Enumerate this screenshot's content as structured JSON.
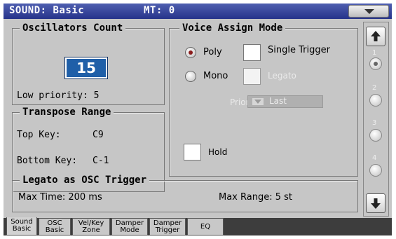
{
  "header": {
    "title": "SOUND: Basic",
    "mt": "MT: 0"
  },
  "oscillators": {
    "title": "Oscillators Count",
    "value": "15",
    "low_priority": "Low priority: 5"
  },
  "transpose": {
    "title": "Transpose Range",
    "top_label": "Top Key:",
    "top_value": "C9",
    "bottom_label": "Bottom Key:",
    "bottom_value": "C-1"
  },
  "voice_assign": {
    "title": "Voice Assign Mode",
    "poly": "Poly",
    "mono": "Mono",
    "single_trigger": "Single Trigger",
    "legato": "Legato",
    "priority_label": "Priority:",
    "priority_value": "Last",
    "hold": "Hold",
    "selected_mode": "Poly"
  },
  "legato_trigger": {
    "title": "Legato as OSC Trigger",
    "max_time": "Max Time: 200  ms",
    "max_range": "Max Range: 5   st"
  },
  "scroll": {
    "pages": [
      "1",
      "2",
      "3",
      "4"
    ],
    "selected_page": "1"
  },
  "tabs": [
    {
      "line1": "Sound",
      "line2": "Basic"
    },
    {
      "line1": "OSC",
      "line2": "Basic"
    },
    {
      "line1": "Vel/Key",
      "line2": "Zone"
    },
    {
      "line1": "Damper",
      "line2": "Mode"
    },
    {
      "line1": "Damper",
      "line2": "Trigger"
    },
    {
      "line1": "EQ",
      "line2": ""
    }
  ],
  "colors": {
    "title_bar": "#26338a",
    "value_box": "#1f5fa8",
    "panel": "#c6c6c6",
    "radio_selected": "#8a1c1c"
  }
}
